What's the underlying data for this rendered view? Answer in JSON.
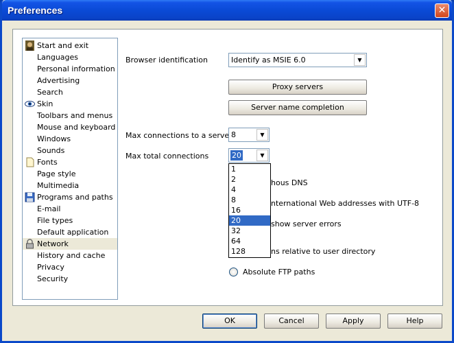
{
  "window": {
    "title": "Preferences",
    "close_glyph": "✕"
  },
  "sidebar": {
    "items": [
      {
        "label": "Start and exit",
        "icon": "monalisa-icon"
      },
      {
        "label": "Languages"
      },
      {
        "label": "Personal information"
      },
      {
        "label": "Advertising"
      },
      {
        "label": "Search"
      },
      {
        "label": "Skin",
        "icon": "eye-icon"
      },
      {
        "label": "Toolbars and menus"
      },
      {
        "label": "Mouse and keyboard"
      },
      {
        "label": "Windows"
      },
      {
        "label": "Sounds"
      },
      {
        "label": "Fonts",
        "icon": "page-icon"
      },
      {
        "label": "Page style"
      },
      {
        "label": "Multimedia"
      },
      {
        "label": "Programs and paths",
        "icon": "floppy-disk-icon"
      },
      {
        "label": "E-mail"
      },
      {
        "label": "File types"
      },
      {
        "label": "Default application"
      },
      {
        "label": "Network",
        "icon": "lock-icon",
        "selected": true
      },
      {
        "label": "History and cache"
      },
      {
        "label": "Privacy"
      },
      {
        "label": "Security"
      }
    ]
  },
  "network": {
    "browser_id_label": "Browser identification",
    "browser_id_value": "Identify as MSIE 6.0",
    "proxy_button": "Proxy servers",
    "server_name_button": "Server name completion",
    "max_server_label": "Max connections to a server",
    "max_server_value": "8",
    "max_total_label": "Max total connections",
    "max_total_value": "20",
    "dropdown_options": [
      "1",
      "2",
      "4",
      "8",
      "16",
      "20",
      "32",
      "64",
      "128"
    ],
    "dropdown_selected": "20",
    "partial_texts": [
      "hous DNS",
      "nternational Web addresses with UTF-8",
      "show server errors",
      "ns relative to user directory"
    ],
    "absolute_ftp_label": "Absolute FTP paths"
  },
  "buttons": {
    "ok": "OK",
    "cancel": "Cancel",
    "apply": "Apply",
    "help": "Help"
  },
  "colors": {
    "selection": "#316ac5",
    "title_bar": "#0a4ad6",
    "dialog_bg": "#ece9d8"
  }
}
